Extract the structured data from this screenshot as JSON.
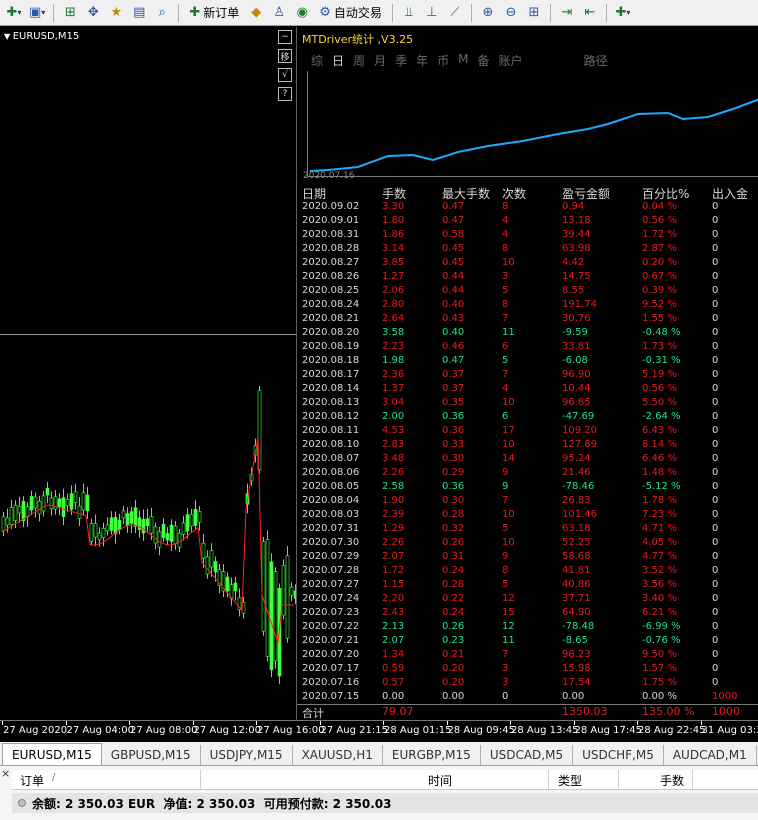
{
  "toolbar": {
    "new_order_label": "新订单",
    "auto_trade_label": "自动交易"
  },
  "chart": {
    "title": "EURUSD,M15",
    "side_buttons": [
      "−",
      "移",
      "√",
      "?"
    ],
    "colors": {
      "candle": "#40ff40",
      "ma": "#ff2020"
    }
  },
  "panel": {
    "title": "MTDriver统计 ,V3.25",
    "tabs": [
      "综",
      "日",
      "周",
      "月",
      "季",
      "年",
      "币",
      "M",
      "备",
      "账户"
    ],
    "active_tab": "日",
    "path_label": "路径",
    "curve_start_label": "2020.07.16",
    "curve_color": "#1ea8ff",
    "headers": [
      "日期",
      "手数",
      "最大手数",
      "次数",
      "盈亏金额",
      "百分比%",
      "出入金"
    ],
    "rows": [
      [
        "2020.09.02",
        "3.30",
        "0.47",
        "8",
        "0.94",
        "0.04 %",
        "0"
      ],
      [
        "2020.09.01",
        "1.80",
        "0.47",
        "4",
        "13.18",
        "0.56 %",
        "0"
      ],
      [
        "2020.08.31",
        "1.86",
        "0.58",
        "4",
        "39.44",
        "1.72 %",
        "0"
      ],
      [
        "2020.08.28",
        "3.14",
        "0.45",
        "8",
        "63.98",
        "2.87 %",
        "0"
      ],
      [
        "2020.08.27",
        "3.85",
        "0.45",
        "10",
        "4.42",
        "0.20 %",
        "0"
      ],
      [
        "2020.08.26",
        "1.27",
        "0.44",
        "3",
        "14.75",
        "0.67 %",
        "0"
      ],
      [
        "2020.08.25",
        "2.06",
        "0.44",
        "5",
        "8.55",
        "0.39 %",
        "0"
      ],
      [
        "2020.08.24",
        "2.80",
        "0.40",
        "8",
        "191.74",
        "9.52 %",
        "0"
      ],
      [
        "2020.08.21",
        "2.64",
        "0.43",
        "7",
        "30.76",
        "1.55 %",
        "0"
      ],
      [
        "2020.08.20",
        "3.58",
        "0.40",
        "11",
        "-9.59",
        "-0.48 %",
        "0"
      ],
      [
        "2020.08.19",
        "2.23",
        "0.46",
        "6",
        "33.81",
        "1.73 %",
        "0"
      ],
      [
        "2020.08.18",
        "1.98",
        "0.47",
        "5",
        "-6.08",
        "-0.31 %",
        "0"
      ],
      [
        "2020.08.17",
        "2.36",
        "0.37",
        "7",
        "96.90",
        "5.19 %",
        "0"
      ],
      [
        "2020.08.14",
        "1.37",
        "0.37",
        "4",
        "10.44",
        "0.56 %",
        "0"
      ],
      [
        "2020.08.13",
        "3.04",
        "0.35",
        "10",
        "96.85",
        "5.50 %",
        "0"
      ],
      [
        "2020.08.12",
        "2.00",
        "0.36",
        "6",
        "-47.69",
        "-2.64 %",
        "0"
      ],
      [
        "2020.08.11",
        "4.53",
        "0.36",
        "17",
        "109.20",
        "6.43 %",
        "0"
      ],
      [
        "2020.08.10",
        "2.83",
        "0.33",
        "10",
        "127.89",
        "8.14 %",
        "0"
      ],
      [
        "2020.08.07",
        "3.48",
        "0.30",
        "14",
        "95.24",
        "6.46 %",
        "0"
      ],
      [
        "2020.08.06",
        "2.26",
        "0.29",
        "9",
        "21.46",
        "1.48 %",
        "0"
      ],
      [
        "2020.08.05",
        "2.58",
        "0.36",
        "9",
        "-78.46",
        "-5.12 %",
        "0"
      ],
      [
        "2020.08.04",
        "1.90",
        "0.30",
        "7",
        "26.83",
        "1.78 %",
        "0"
      ],
      [
        "2020.08.03",
        "2.39",
        "0.28",
        "10",
        "101.46",
        "7.23 %",
        "0"
      ],
      [
        "2020.07.31",
        "1.29",
        "0.32",
        "5",
        "63.18",
        "4.71 %",
        "0"
      ],
      [
        "2020.07.30",
        "2.26",
        "0.26",
        "10",
        "52.25",
        "4.05 %",
        "0"
      ],
      [
        "2020.07.29",
        "2.07",
        "0.31",
        "9",
        "58.68",
        "4.77 %",
        "0"
      ],
      [
        "2020.07.28",
        "1.72",
        "0.24",
        "8",
        "41.81",
        "3.52 %",
        "0"
      ],
      [
        "2020.07.27",
        "1.15",
        "0.28",
        "5",
        "40.86",
        "3.56 %",
        "0"
      ],
      [
        "2020.07.24",
        "2.20",
        "0.22",
        "12",
        "37.71",
        "3.40 %",
        "0"
      ],
      [
        "2020.07.23",
        "2.43",
        "0.24",
        "15",
        "64.90",
        "6.21 %",
        "0"
      ],
      [
        "2020.07.22",
        "2.13",
        "0.26",
        "12",
        "-78.48",
        "-6.99 %",
        "0"
      ],
      [
        "2020.07.21",
        "2.07",
        "0.23",
        "11",
        "-8.65",
        "-0.76 %",
        "0"
      ],
      [
        "2020.07.20",
        "1.34",
        "0.21",
        "7",
        "98.23",
        "9.50 %",
        "0"
      ],
      [
        "2020.07.17",
        "0.59",
        "0.20",
        "3",
        "15.98",
        "1.57 %",
        "0"
      ],
      [
        "2020.07.16",
        "0.57",
        "0.20",
        "3",
        "17.54",
        "1.75 %",
        "0"
      ],
      [
        "2020.07.15",
        "0.00",
        "0.00",
        "0",
        "0.00",
        "0.00 %",
        "1000"
      ]
    ],
    "total": [
      "合计",
      "79.07",
      "",
      "",
      "1350.03",
      "135.00 %",
      "1000"
    ]
  },
  "time_axis": [
    "27 Aug 2020",
    "27 Aug 04:00",
    "27 Aug 08:00",
    "27 Aug 12:00",
    "27 Aug 16:00",
    "27 Aug 21:15",
    "28 Aug 01:15",
    "28 Aug 09:45",
    "28 Aug 13:45",
    "28 Aug 17:45",
    "28 Aug 22:45",
    "31 Aug 03:30"
  ],
  "symbol_tabs": [
    "EURUSD,M15",
    "GBPUSD,M15",
    "USDJPY,M15",
    "XAUUSD,H1",
    "EURGBP,M15",
    "USDCAD,M5",
    "USDCHF,M5",
    "AUDCAD,M1"
  ],
  "terminal": {
    "headers": [
      "订单",
      "/",
      "时间",
      "类型",
      "手数"
    ],
    "balance_line": "余额: 2 350.03 EUR  净值: 2 350.03  可用预付款: 2 350.03"
  }
}
